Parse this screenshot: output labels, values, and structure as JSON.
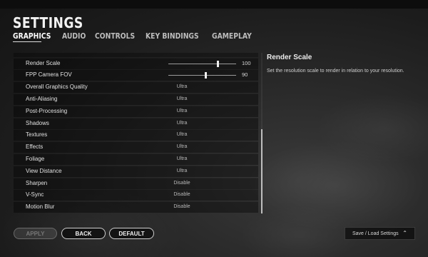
{
  "header": {
    "title": "SETTINGS",
    "tabs": [
      {
        "label": "GRAPHICS",
        "active": true
      },
      {
        "label": "AUDIO",
        "active": false
      },
      {
        "label": "CONTROLS",
        "active": false
      },
      {
        "label": "KEY BINDINGS",
        "active": false
      },
      {
        "label": "GAMEPLAY",
        "active": false
      }
    ]
  },
  "settings": [
    {
      "label": "Render Scale",
      "type": "slider",
      "value": "100",
      "level": 0.73
    },
    {
      "label": "FPP Camera FOV",
      "type": "slider",
      "value": "90",
      "level": 0.55
    },
    {
      "label": "Overall Graphics Quality",
      "type": "option",
      "value": "Ultra"
    },
    {
      "label": "Anti-Aliasing",
      "type": "option",
      "value": "Ultra"
    },
    {
      "label": "Post-Processing",
      "type": "option",
      "value": "Ultra"
    },
    {
      "label": "Shadows",
      "type": "option",
      "value": "Ultra"
    },
    {
      "label": "Textures",
      "type": "option",
      "value": "Ultra"
    },
    {
      "label": "Effects",
      "type": "option",
      "value": "Ultra"
    },
    {
      "label": "Foliage",
      "type": "option",
      "value": "Ultra"
    },
    {
      "label": "View Distance",
      "type": "option",
      "value": "Ultra"
    },
    {
      "label": "Sharpen",
      "type": "option",
      "value": "Disable"
    },
    {
      "label": "V-Sync",
      "type": "option",
      "value": "Disable"
    },
    {
      "label": "Motion Blur",
      "type": "option",
      "value": "Disable"
    }
  ],
  "info": {
    "title": "Render Scale",
    "description": "Set the resolution scale to render in relation to your resolution."
  },
  "footer": {
    "apply_label": "APPLY",
    "back_label": "BACK",
    "default_label": "DEFAULT",
    "save_load_label": "Save / Load Settings"
  }
}
